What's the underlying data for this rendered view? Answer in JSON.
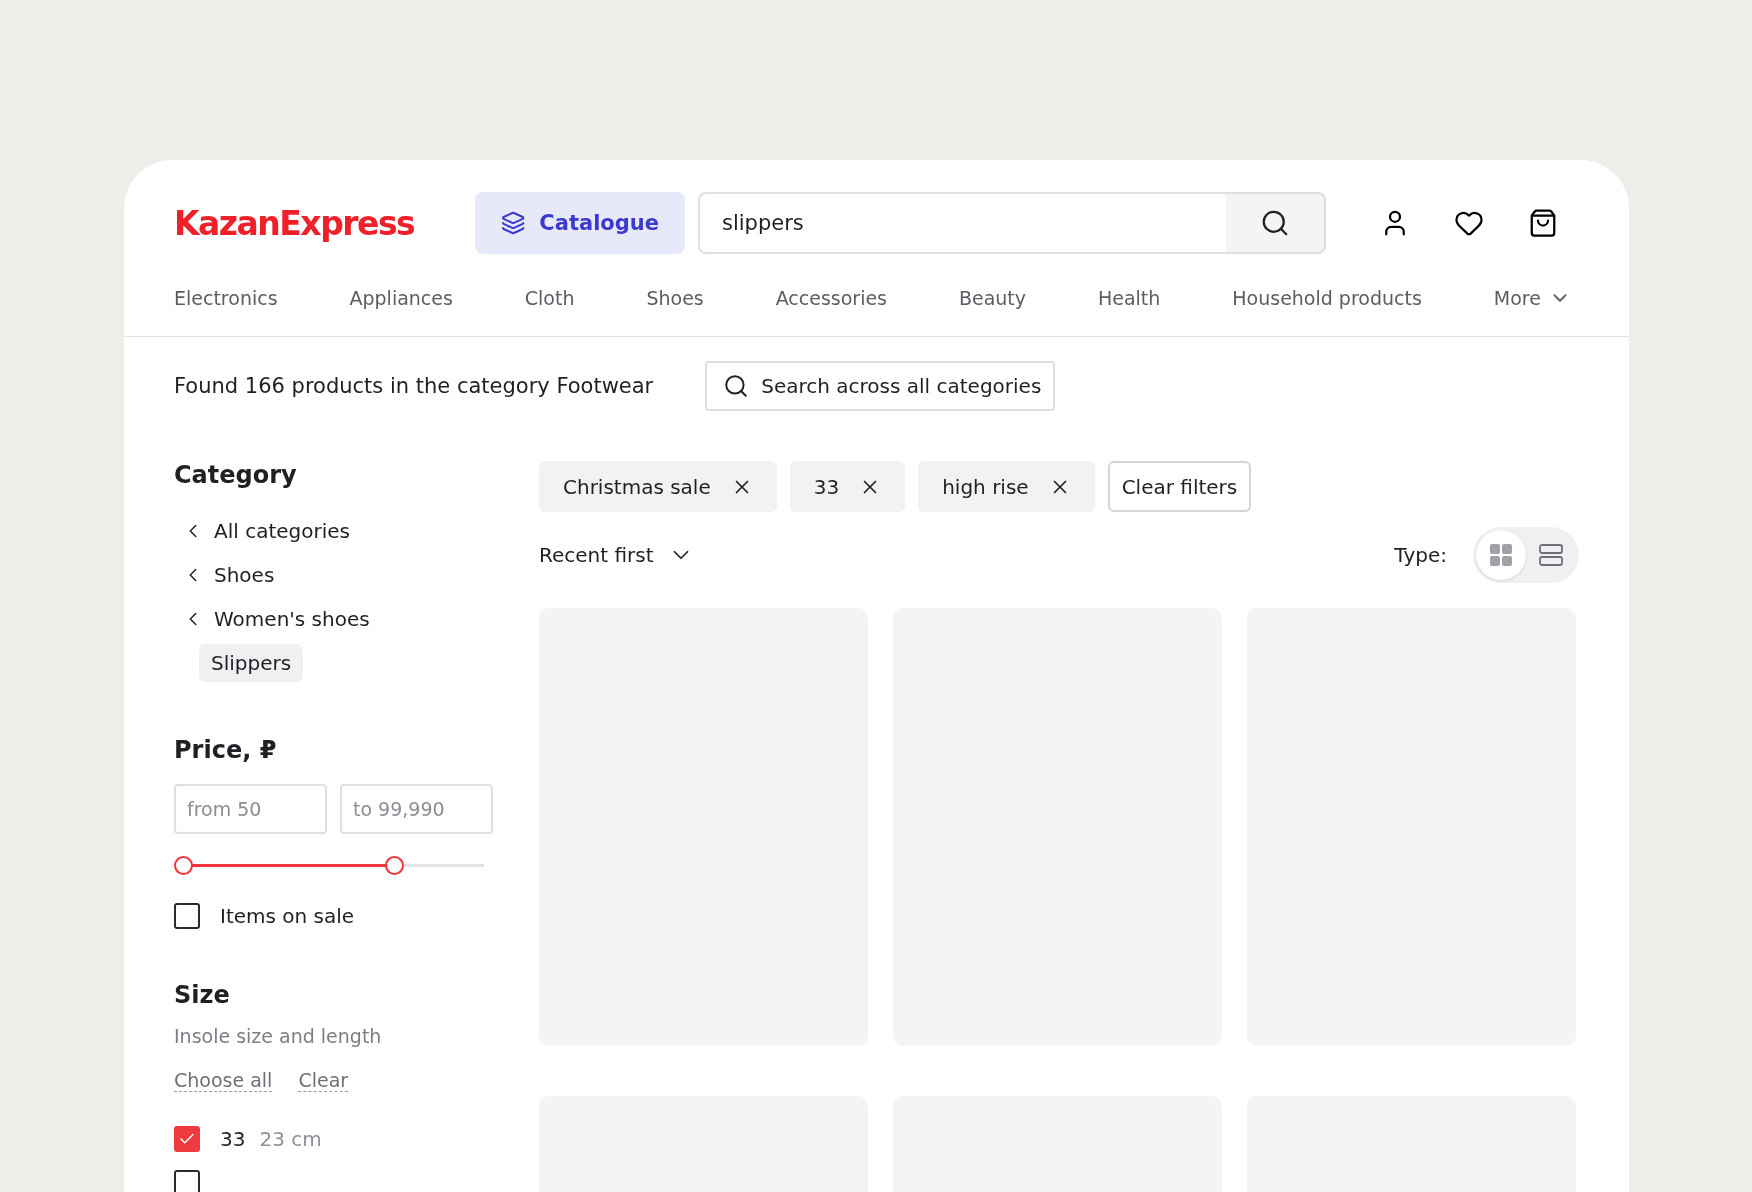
{
  "header": {
    "logo": "KazanExpress",
    "catalogue_button": "Catalogue",
    "search": {
      "value": "slippers"
    }
  },
  "nav": [
    "Electronics",
    "Appliances",
    "Cloth",
    "Shoes",
    "Accessories",
    "Beauty",
    "Health",
    "Household products"
  ],
  "nav_more": "More",
  "result_text": "Found 166 products in the category Footwear",
  "search_all_button": "Search across all categories",
  "category": {
    "title": "Category",
    "items": [
      {
        "label": "All categories",
        "kind": "parent",
        "selected": false
      },
      {
        "label": "Shoes",
        "kind": "parent",
        "selected": false
      },
      {
        "label": "Women's shoes",
        "kind": "parent",
        "selected": false
      },
      {
        "label": "Slippers",
        "kind": "current",
        "selected": true
      }
    ]
  },
  "price": {
    "title": "Price, ₽",
    "from": {
      "placeholder": "from 50"
    },
    "to": {
      "placeholder": "to 99,990"
    },
    "thumbs": [
      {
        "level": 0
      },
      {
        "level": 0.7
      }
    ],
    "on_sale": {
      "label": "Items on sale",
      "checked": false
    }
  },
  "size": {
    "title": "Size",
    "subtitle": "Insole size and length",
    "links": [
      "Choose all",
      "Clear"
    ],
    "items": [
      {
        "size": "33",
        "length": "23 cm",
        "checked": true
      },
      {
        "checked": false
      }
    ]
  },
  "active_filters": [
    "Christmas sale",
    "33",
    "high rise"
  ],
  "clear_filters": "Clear filters",
  "sort": "Recent first",
  "view": {
    "label": "Type:",
    "options": [
      {
        "kind": "grid",
        "selected": true
      },
      {
        "kind": "list",
        "selected": false
      }
    ]
  },
  "products": [
    {
      "kind": "picture"
    },
    {
      "kind": "picture"
    },
    {
      "kind": "picture"
    },
    {
      "kind": "picture"
    },
    {
      "kind": "picture"
    },
    {
      "kind": "picture"
    }
  ]
}
